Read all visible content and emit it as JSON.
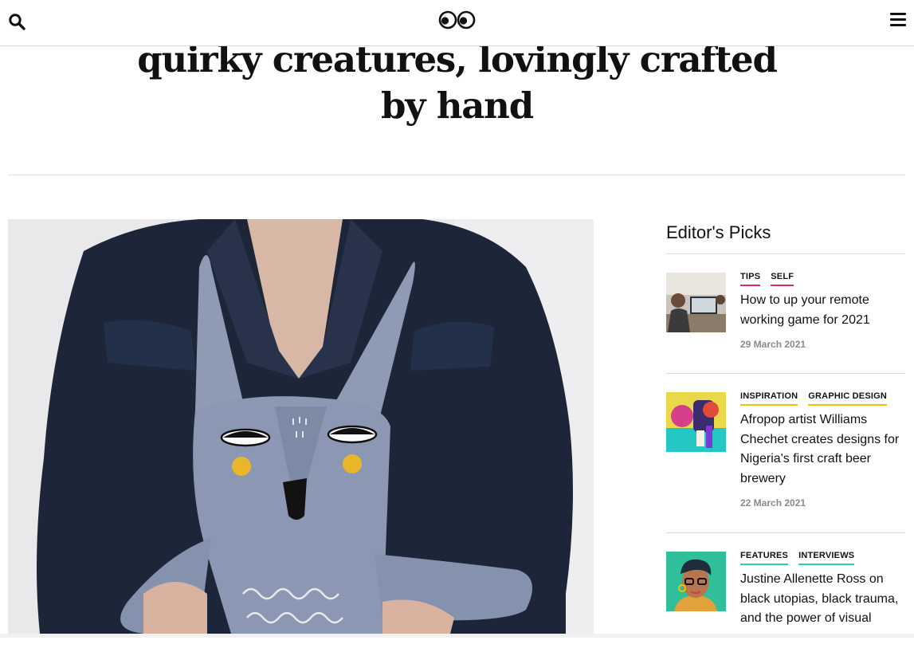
{
  "header": {
    "search_icon": "search-icon",
    "logo_icon": "googly-eyes-logo",
    "menu_icon": "hamburger-menu-icon"
  },
  "article": {
    "title_line1": "quirky creatures, lovingly crafted",
    "title_line2": "by hand"
  },
  "sidebar": {
    "title": "Editor's Picks",
    "items": [
      {
        "tags": [
          {
            "label": "TIPS",
            "color": "#e2266e"
          },
          {
            "label": "SELF",
            "color": "#e2266e"
          }
        ],
        "title": "How to up your remote working game for 2021",
        "date": "29 March 2021"
      },
      {
        "tags": [
          {
            "label": "INSPIRATION",
            "color": "#f2c200"
          },
          {
            "label": "GRAPHIC DESIGN",
            "color": "#f2c200"
          }
        ],
        "title": "Afropop artist Williams Chechet creates designs for Nigeria's first craft beer brewery",
        "date": "22 March 2021"
      },
      {
        "tags": [
          {
            "label": "FEATURES",
            "color": "#2ecfb1"
          },
          {
            "label": "INTERVIEWS",
            "color": "#2ecfb1"
          }
        ],
        "title": "Justine Allenette Ross on black utopias, black trauma, and the power of visual",
        "date": ""
      }
    ]
  }
}
